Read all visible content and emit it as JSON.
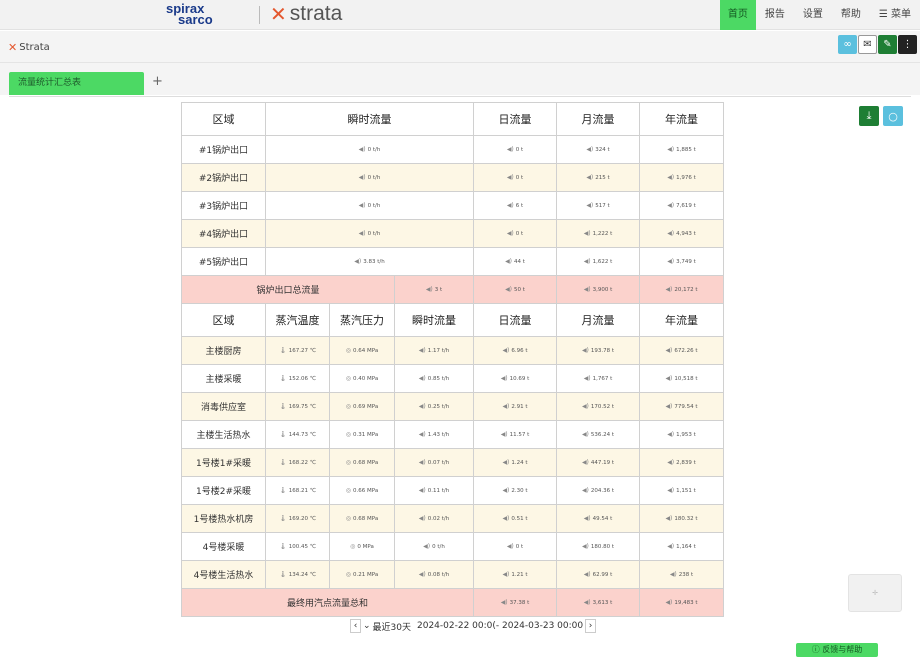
{
  "header": {
    "brand_spirax": "spirax",
    "brand_sarco": "sarco",
    "brand_strata": "strata",
    "nav": [
      "首页",
      "报告",
      "设置",
      "帮助",
      "菜单"
    ]
  },
  "subheader": {
    "app_name": "Strata"
  },
  "tabs": {
    "items": [
      "流量统计汇总表"
    ],
    "add_label": "+"
  },
  "table1": {
    "headers": [
      "区域",
      "瞬时流量",
      "日流量",
      "月流量",
      "年流量"
    ],
    "rows": [
      {
        "area": "#1锅炉出口",
        "inst": "0 t/h",
        "day": "0 t",
        "month": "324 t",
        "year": "1,885 t"
      },
      {
        "area": "#2锅炉出口",
        "inst": "0 t/h",
        "day": "0 t",
        "month": "215 t",
        "year": "1,976 t"
      },
      {
        "area": "#3锅炉出口",
        "inst": "0 t/h",
        "day": "6 t",
        "month": "517 t",
        "year": "7,619 t"
      },
      {
        "area": "#4锅炉出口",
        "inst": "0 t/h",
        "day": "0 t",
        "month": "1,222 t",
        "year": "4,943 t"
      },
      {
        "area": "#5锅炉出口",
        "inst": "3.83 t/h",
        "day": "44 t",
        "month": "1,622 t",
        "year": "3,749 t"
      }
    ],
    "total": {
      "label": "锅炉出口总流量",
      "inst": "3 t",
      "day": "50 t",
      "month": "3,900 t",
      "year": "20,172 t"
    }
  },
  "table2": {
    "headers": [
      "区域",
      "蒸汽温度",
      "蒸汽压力",
      "瞬时流量",
      "日流量",
      "月流量",
      "年流量"
    ],
    "rows": [
      {
        "area": "主楼厨房",
        "temp": "167.27 ℃",
        "pres": "0.64 MPa",
        "inst": "1.17 t/h",
        "day": "6.96 t",
        "month": "193.78 t",
        "year": "672.26 t"
      },
      {
        "area": "主楼采暖",
        "temp": "152.06 ℃",
        "pres": "0.40 MPa",
        "inst": "0.85 t/h",
        "day": "10.69 t",
        "month": "1,767 t",
        "year": "10,518 t"
      },
      {
        "area": "消毒供应室",
        "temp": "169.75 ℃",
        "pres": "0.69 MPa",
        "inst": "0.25 t/h",
        "day": "2.91 t",
        "month": "170.52 t",
        "year": "779.54 t"
      },
      {
        "area": "主楼生活热水",
        "temp": "144.73 ℃",
        "pres": "0.31 MPa",
        "inst": "1.43 t/h",
        "day": "11.57 t",
        "month": "536.24 t",
        "year": "1,953 t"
      },
      {
        "area": "1号楼1#采暖",
        "temp": "168.22 ℃",
        "pres": "0.68 MPa",
        "inst": "0.07 t/h",
        "day": "1.24 t",
        "month": "447.19 t",
        "year": "2,839 t"
      },
      {
        "area": "1号楼2#采暖",
        "temp": "168.21 ℃",
        "pres": "0.66 MPa",
        "inst": "0.11 t/h",
        "day": "2.30 t",
        "month": "204.36 t",
        "year": "1,151 t"
      },
      {
        "area": "1号楼热水机房",
        "temp": "169.20 ℃",
        "pres": "0.68 MPa",
        "inst": "0.02 t/h",
        "day": "0.51 t",
        "month": "49.54 t",
        "year": "180.32 t"
      },
      {
        "area": "4号楼采暖",
        "temp": "100.45 ℃",
        "pres": "0 MPa",
        "inst": "0 t/h",
        "day": "0 t",
        "month": "180.80 t",
        "year": "1,164 t"
      },
      {
        "area": "4号楼生活热水",
        "temp": "134.24 ℃",
        "pres": "0.21 MPa",
        "inst": "0.08 t/h",
        "day": "1.21 t",
        "month": "62.99 t",
        "year": "238 t"
      }
    ],
    "total": {
      "label": "最终用汽点流量总和",
      "day": "37.38 t",
      "month": "3,613 t",
      "year": "19,483 t"
    }
  },
  "footer": {
    "range_label": "最近30天",
    "range_value": "2024-02-22 00:0(- 2024-03-23 00:00",
    "feedback": "反馈与帮助"
  },
  "colors": {
    "accent": "#4cd964",
    "yellow_row": "#fdf7e5",
    "pink_row": "#fbd2cc",
    "teal": "#5bc0de",
    "dark_green": "#1e7e34"
  }
}
